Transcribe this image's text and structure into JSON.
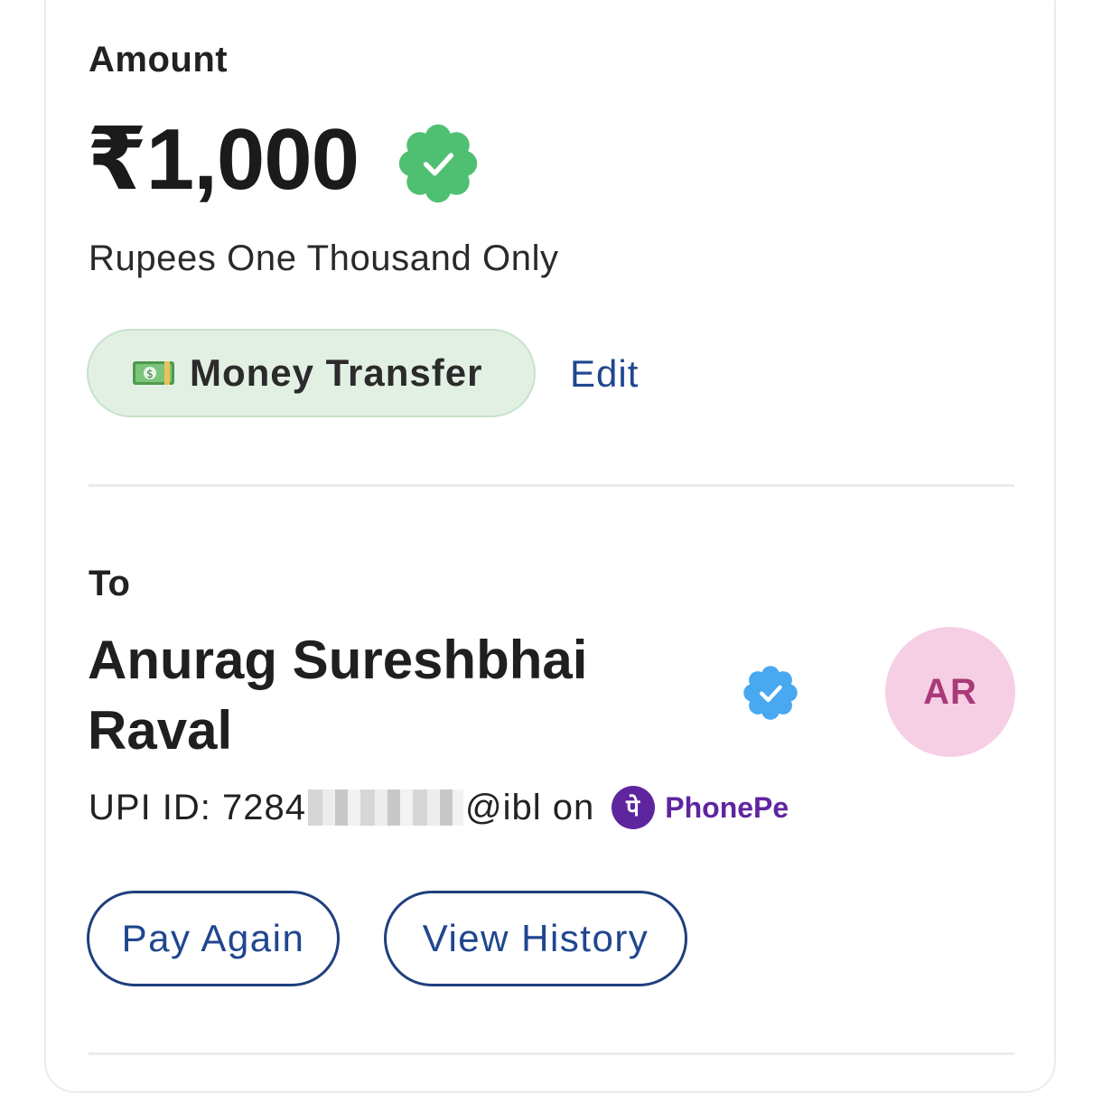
{
  "amount": {
    "label": "Amount",
    "value": "₹1,000",
    "in_words": "Rupees One Thousand Only",
    "verified_icon": "verified-badge-icon",
    "verified_color": "#4fbf72"
  },
  "category": {
    "icon": "money-banknote-icon",
    "label": "Money Transfer",
    "edit_label": "Edit"
  },
  "recipient": {
    "section_label": "To",
    "name": "Anurag Sureshbhai Raval",
    "verified_icon": "verified-badge-icon",
    "verified_color": "#48a8f0",
    "avatar_initials": "AR",
    "upi_prefix": "UPI ID: 7284",
    "upi_suffix": "@ibl on",
    "app_name": "PhonePe",
    "app_color": "#5f259f"
  },
  "actions": {
    "pay_again": "Pay Again",
    "view_history": "View History"
  },
  "colors": {
    "link": "#20468f",
    "pill_bg": "#e2f0e4",
    "avatar_bg": "#f6cfe5",
    "avatar_text": "#a93a78"
  }
}
